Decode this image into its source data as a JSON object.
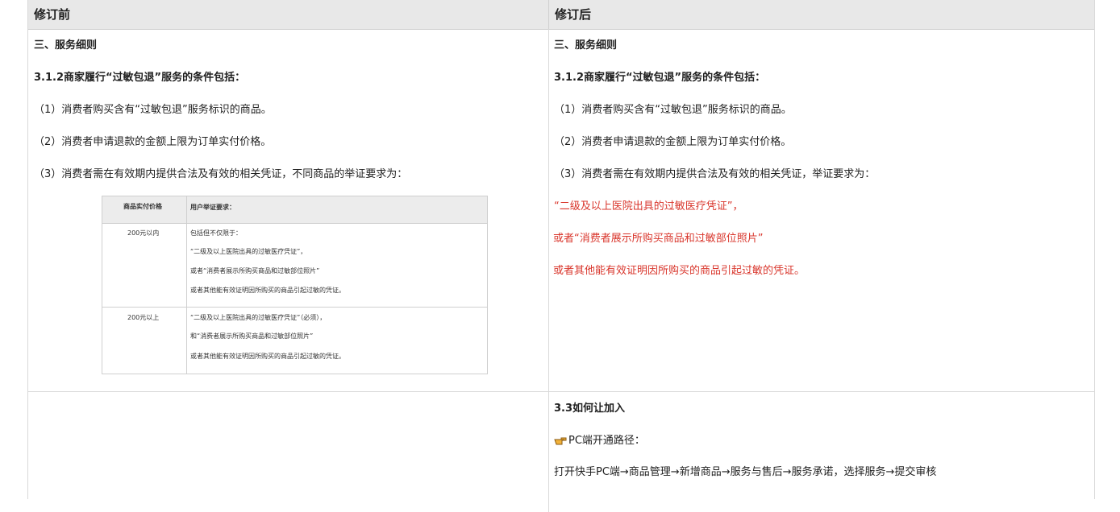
{
  "headers": {
    "before": "修订前",
    "after": "修订后"
  },
  "before": {
    "section": "三、服务细则",
    "clause": "3.1.2商家履行“过敏包退”服务的条件包括：",
    "item1": "（1）消费者购买含有“过敏包退”服务标识的商品。",
    "item2": "（2）消费者申请退款的金额上限为订单实付价格。",
    "item3": "（3）消费者需在有效期内提供合法及有效的相关凭证，不同商品的举证要求为：",
    "evidence_table": {
      "col1": "商品实付价格",
      "col2": "用户举证要求：",
      "rows": [
        {
          "price": "200元以内",
          "lines": [
            "包括但不仅限于：",
            "“二级及以上医院出具的过敏医疗凭证”，",
            "或者“消费者展示所购买商品和过敏部位照片”",
            "或者其他能有效证明因所购买的商品引起过敏的凭证。"
          ]
        },
        {
          "price": "200元以上",
          "lines": [
            "“二级及以上医院出具的过敏医疗凭证”（必须），",
            "和“消费者展示所购买商品和过敏部位照片”",
            "或者其他能有效证明因所购买的商品引起过敏的凭证。"
          ]
        }
      ]
    }
  },
  "after": {
    "section": "三、服务细则",
    "clause": "3.1.2商家履行“过敏包退”服务的条件包括：",
    "item1": "（1）消费者购买含有“过敏包退”服务标识的商品。",
    "item2": "（2）消费者申请退款的金额上限为订单实付价格。",
    "item3": "（3）消费者需在有效期内提供合法及有效的相关凭证，举证要求为：",
    "red1": "“二级及以上医院出具的过敏医疗凭证”，",
    "red2": "或者“消费者展示所购买商品和过敏部位照片”",
    "red3": "或者其他能有效证明因所购买的商品引起过敏的凭证。",
    "red_color": "#d9362c"
  },
  "after_row2": {
    "heading": "3.3如何让加入",
    "pc_label": "PC端开通路径：",
    "pc_icon": "pointing-hand-icon",
    "path": "打开快手PC端→商品管理→新增商品→服务与售后→服务承诺，选择服务→提交审核"
  }
}
